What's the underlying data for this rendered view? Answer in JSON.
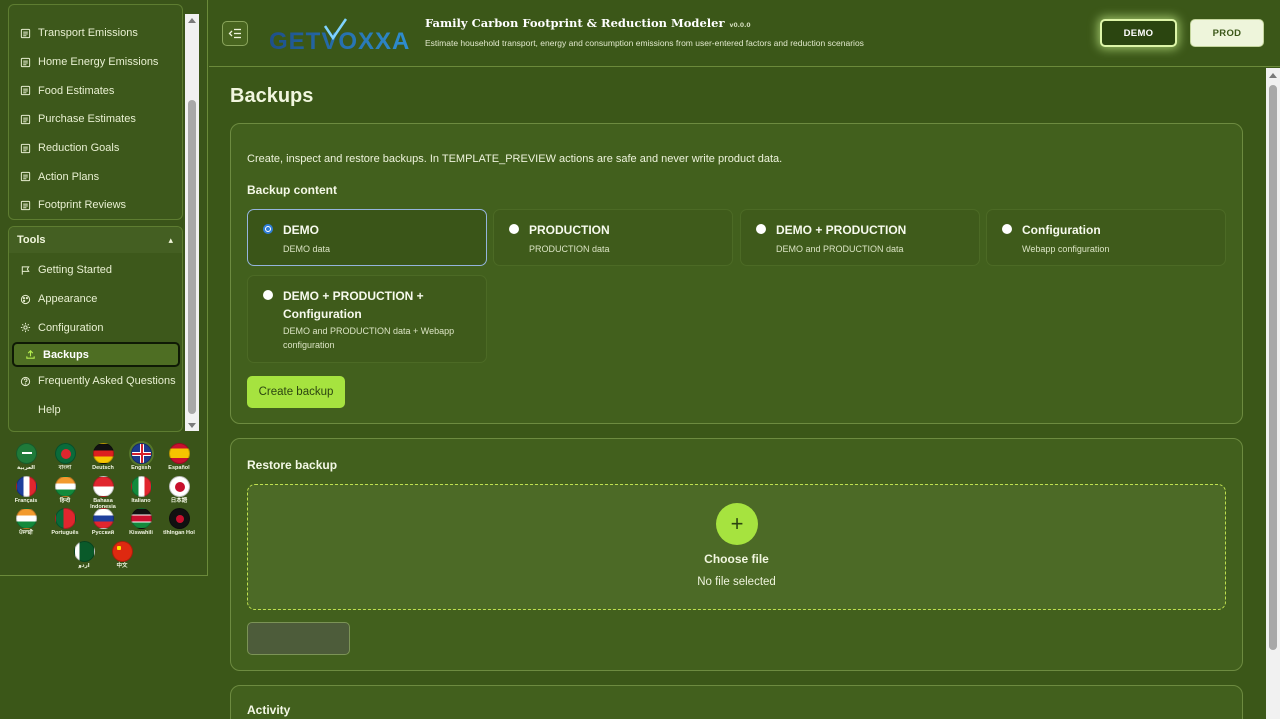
{
  "sidebar": {
    "group_top": [
      {
        "label": "Transport Emissions",
        "icon": "document-icon"
      },
      {
        "label": "Home Energy Emissions",
        "icon": "document-icon"
      },
      {
        "label": "Food Estimates",
        "icon": "document-icon"
      },
      {
        "label": "Purchase Estimates",
        "icon": "document-icon"
      },
      {
        "label": "Reduction Goals",
        "icon": "document-icon"
      },
      {
        "label": "Action Plans",
        "icon": "document-icon"
      },
      {
        "label": "Footprint Reviews",
        "icon": "document-icon"
      }
    ],
    "tools_title": "Tools",
    "tools": [
      {
        "label": "Getting Started",
        "icon": "flag-icon"
      },
      {
        "label": "Appearance",
        "icon": "palette-icon"
      },
      {
        "label": "Configuration",
        "icon": "gear-icon"
      },
      {
        "label": "Backups",
        "icon": "upload-icon",
        "active": true
      },
      {
        "label": "Frequently Asked Questions",
        "icon": "question-icon"
      },
      {
        "label": "Help",
        "icon": ""
      }
    ],
    "languages": [
      "العربية",
      "বাংলা",
      "Deutsch",
      "English",
      "Español",
      "Français",
      "हिन्दी",
      "Bahasa Indonesia",
      "Italiano",
      "日本語",
      "ਪੰਜਾਬੀ",
      "Português",
      "Русский",
      "Kiswahili",
      "tlhIngan Hol",
      "اردو",
      "中文"
    ],
    "selected_language": "English"
  },
  "header": {
    "logo_text": "GETVOXXA",
    "title": "Family Carbon Footprint & Reduction Modeler",
    "version": "v0.0.0",
    "subtitle": "Estimate household transport, energy and consumption emissions from user-entered factors and reduction scenarios",
    "demo_label": "DEMO",
    "prod_label": "PROD"
  },
  "main": {
    "page_title": "Backups",
    "backup": {
      "description": "Create, inspect and restore backups. In TEMPLATE_PREVIEW actions are safe and never write product data.",
      "content_heading": "Backup content",
      "options": [
        {
          "title": "DEMO",
          "desc": "DEMO data",
          "selected": true
        },
        {
          "title": "PRODUCTION",
          "desc": "PRODUCTION data",
          "selected": false
        },
        {
          "title": "DEMO + PRODUCTION",
          "desc": "DEMO and PRODUCTION data",
          "selected": false
        },
        {
          "title": "Configuration",
          "desc": "Webapp configuration",
          "selected": false
        },
        {
          "title": "DEMO + PRODUCTION + Configuration",
          "desc": "DEMO and PRODUCTION data + Webapp configuration",
          "selected": false
        }
      ],
      "create_label": "Create backup"
    },
    "restore": {
      "heading": "Restore backup",
      "plus": "+",
      "choose_file": "Choose file",
      "no_file": "No file selected",
      "restore_label": ""
    },
    "activity": {
      "heading": "Activity"
    }
  },
  "colors": {
    "background": "#3b5718",
    "accent": "#a6e33f",
    "card": "#42601d",
    "selected_radio": "#2f7ed8"
  }
}
